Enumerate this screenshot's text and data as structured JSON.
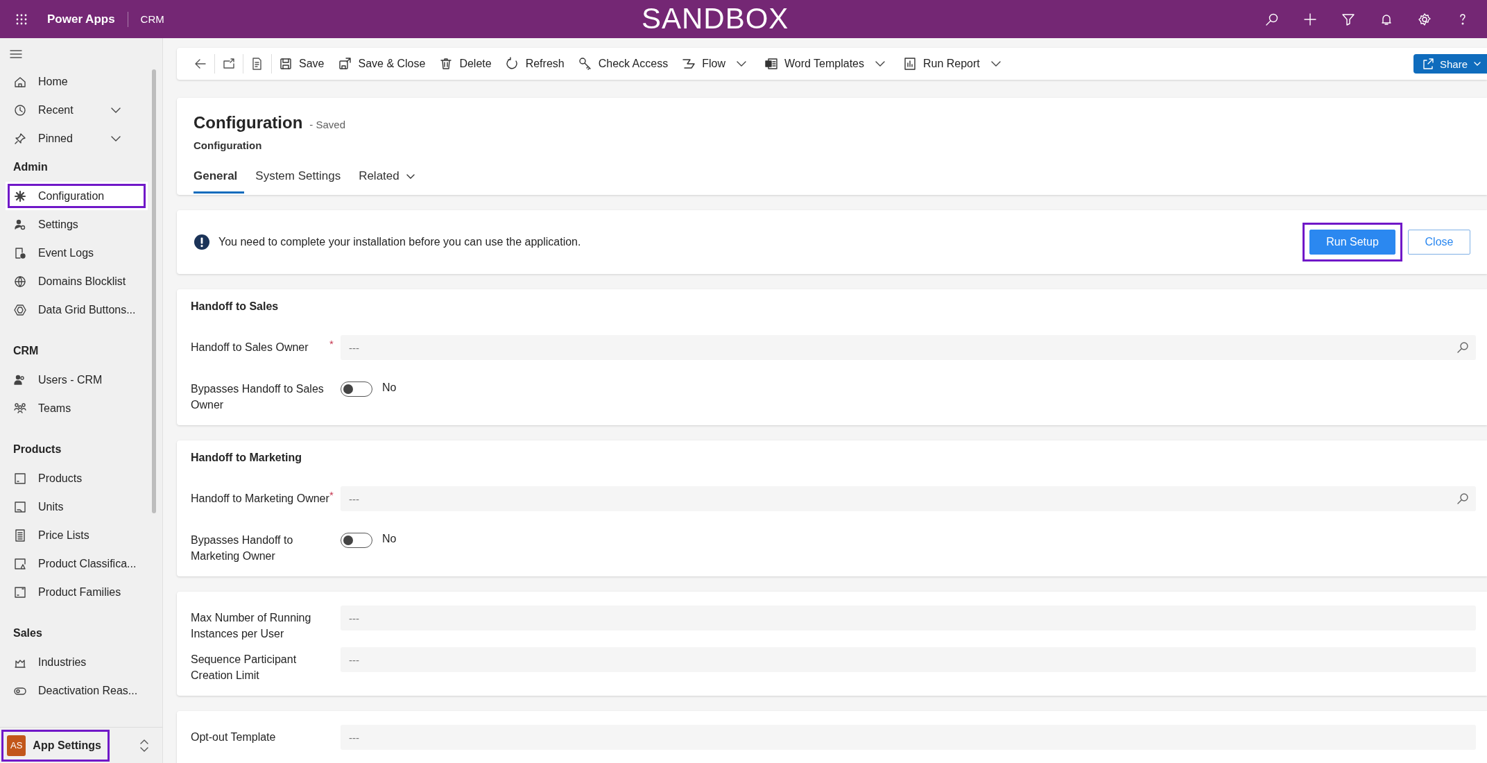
{
  "top_bar": {
    "app_name": "Power Apps",
    "area": "CRM",
    "environment": "SANDBOX"
  },
  "command_bar": {
    "items": [
      {
        "kind": "icon"
      },
      {
        "kind": "icon"
      },
      {
        "kind": "icon"
      },
      {
        "kind": "button",
        "label": "Save"
      },
      {
        "kind": "button",
        "label": "Save & Close"
      },
      {
        "kind": "button",
        "label": "Delete"
      },
      {
        "kind": "button",
        "label": "Refresh"
      },
      {
        "kind": "button",
        "label": "Check Access"
      },
      {
        "kind": "split",
        "label": "Flow"
      },
      {
        "kind": "split",
        "label": "Word Templates"
      },
      {
        "kind": "split",
        "label": "Run Report"
      }
    ],
    "share": {
      "label": "Share"
    }
  },
  "sidebar": {
    "groups": [
      {
        "items": [
          {
            "label": "Home",
            "expandable": false,
            "selected": false,
            "highlighted": false
          },
          {
            "label": "Recent",
            "expandable": true,
            "selected": false,
            "highlighted": false
          },
          {
            "label": "Pinned",
            "expandable": true,
            "selected": false,
            "highlighted": false
          }
        ]
      },
      {
        "heading": "Admin",
        "items": [
          {
            "label": "Configuration",
            "expandable": false,
            "selected": true,
            "highlighted": true
          },
          {
            "label": "Settings",
            "expandable": false,
            "selected": false,
            "highlighted": false
          },
          {
            "label": "Event Logs",
            "expandable": false,
            "selected": false,
            "highlighted": false
          },
          {
            "label": "Domains Blocklist",
            "expandable": false,
            "selected": false,
            "highlighted": false
          },
          {
            "label": "Data Grid Buttons...",
            "expandable": false,
            "selected": false,
            "highlighted": false
          }
        ]
      },
      {
        "heading": "CRM",
        "items": [
          {
            "label": "Users - CRM",
            "expandable": false,
            "selected": false,
            "highlighted": false
          },
          {
            "label": "Teams",
            "expandable": false,
            "selected": false,
            "highlighted": false
          }
        ]
      },
      {
        "heading": "Products",
        "items": [
          {
            "label": "Products",
            "expandable": false,
            "selected": false,
            "highlighted": false
          },
          {
            "label": "Units",
            "expandable": false,
            "selected": false,
            "highlighted": false
          },
          {
            "label": "Price Lists",
            "expandable": false,
            "selected": false,
            "highlighted": false
          },
          {
            "label": "Product Classifica...",
            "expandable": false,
            "selected": false,
            "highlighted": false
          },
          {
            "label": "Product Families",
            "expandable": false,
            "selected": false,
            "highlighted": false
          }
        ]
      },
      {
        "heading": "Sales",
        "items": [
          {
            "label": "Industries",
            "expandable": false,
            "selected": false,
            "highlighted": false
          },
          {
            "label": "Deactivation Reas...",
            "expandable": false,
            "selected": false,
            "highlighted": false
          }
        ]
      }
    ],
    "footer": {
      "initials": "AS",
      "label": "App Settings",
      "highlighted": true
    }
  },
  "record": {
    "title": "Configuration",
    "status": "- Saved",
    "entity": "Configuration",
    "tabs": [
      {
        "label": "General",
        "selected": true,
        "has_menu": false
      },
      {
        "label": "System Settings",
        "selected": false,
        "has_menu": false
      },
      {
        "label": "Related",
        "selected": false,
        "has_menu": true
      }
    ]
  },
  "notice": {
    "message": "You need to complete your installation before you can use the application.",
    "buttons": [
      {
        "label": "Run Setup",
        "kind": "primary",
        "highlighted": true
      },
      {
        "label": "Close",
        "kind": "secondary",
        "highlighted": false
      }
    ]
  },
  "sections": [
    {
      "heading": "Handoff to Sales",
      "fields": [
        {
          "kind": "lookup",
          "label": "Handoff to Sales Owner",
          "required_mark": "*",
          "placeholder": "---"
        },
        {
          "kind": "toggle",
          "label": "Bypasses Handoff to Sales Owner",
          "on": false,
          "state_label": "No"
        }
      ]
    },
    {
      "heading": "Handoff to Marketing",
      "fields": [
        {
          "kind": "lookup",
          "label": "Handoff to Marketing Owner",
          "required_mark": "*",
          "placeholder": "---"
        },
        {
          "kind": "toggle",
          "label": "Bypasses Handoff to Marketing Owner",
          "on": false,
          "state_label": "No"
        }
      ]
    },
    {
      "fields": [
        {
          "kind": "text",
          "label": "Max Number of Running Instances per User",
          "placeholder": "---"
        },
        {
          "kind": "text",
          "label": "Sequence Participant Creation Limit",
          "placeholder": "---"
        }
      ]
    },
    {
      "fields": [
        {
          "kind": "text",
          "label": "Opt-out Template",
          "placeholder": "---"
        }
      ]
    }
  ]
}
